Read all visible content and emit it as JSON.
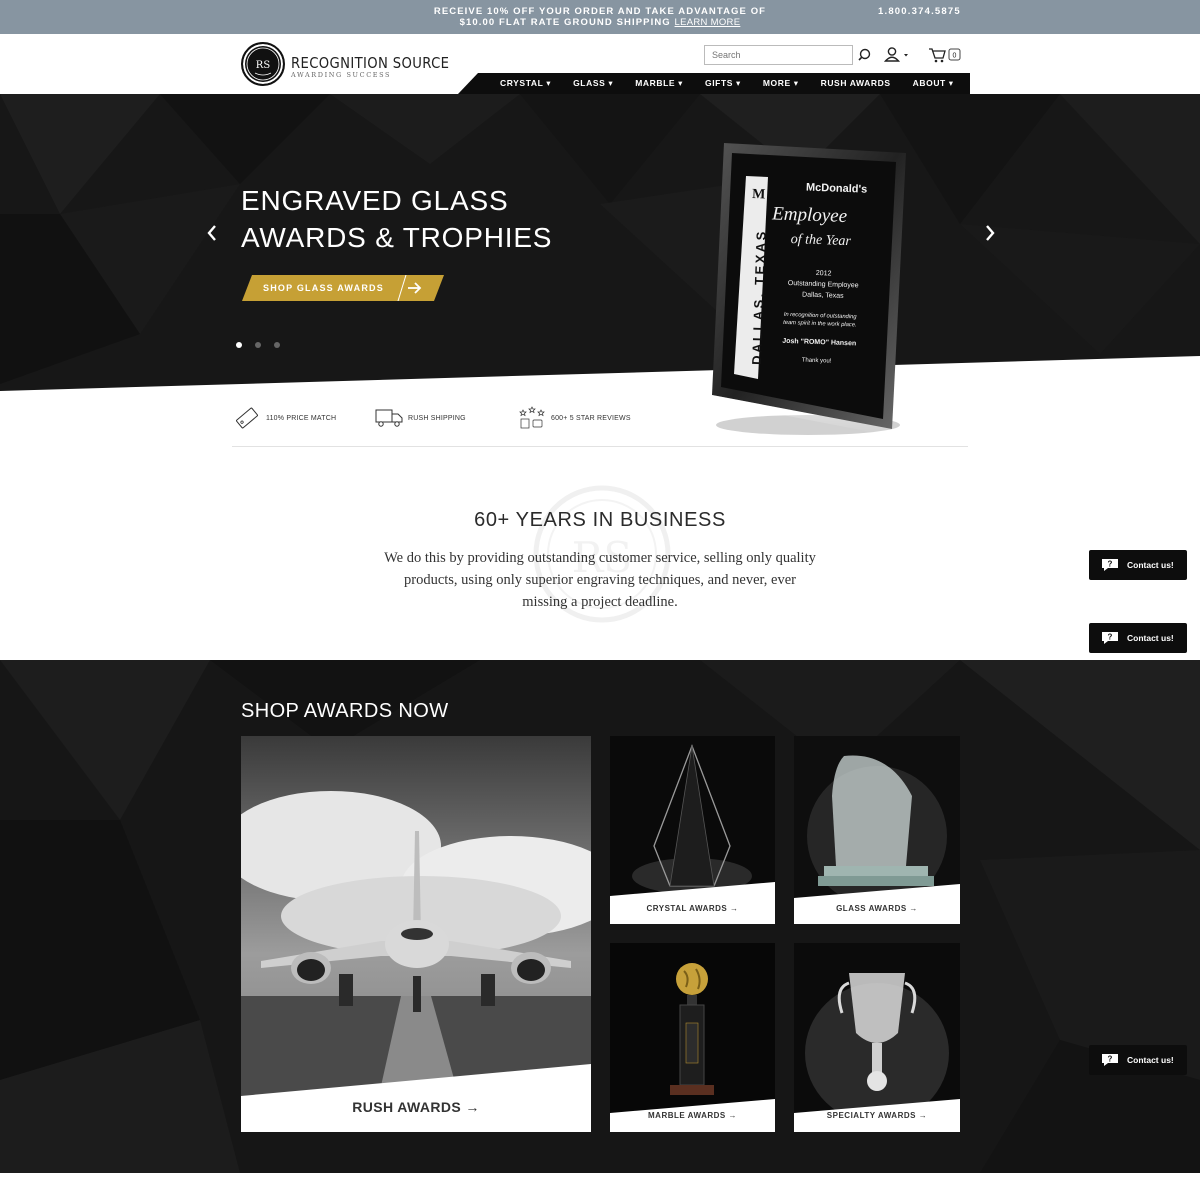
{
  "promo": {
    "line1": "RECEIVE 10% OFF YOUR ORDER AND TAKE ADVANTAGE OF",
    "line2": "$10.00 FLAT RATE GROUND SHIPPING",
    "learn_more": "LEARN MORE",
    "phone": "1.800.374.5875"
  },
  "header": {
    "logo_monogram": "RS",
    "logo_name": "RECOGNITION SOURCE",
    "logo_tagline": "AWARDING SUCCESS",
    "search_placeholder": "Search",
    "cart_count": "0"
  },
  "nav": {
    "items": [
      {
        "label": "CRYSTAL ▾"
      },
      {
        "label": "GLASS ▾"
      },
      {
        "label": "MARBLE ▾"
      },
      {
        "label": "GIFTS ▾"
      },
      {
        "label": "MORE ▾"
      },
      {
        "label": "RUSH AWARDS"
      },
      {
        "label": "ABOUT ▾"
      }
    ]
  },
  "hero": {
    "title_line1": "ENGRAVED GLASS",
    "title_line2": "AWARDS & TROPHIES",
    "cta_label": "SHOP GLASS AWARDS",
    "slide_count": 3,
    "active_slide": 1,
    "plaque": {
      "vertical_text": "DALLAS, TEXAS",
      "brand": "McDonald's",
      "line_employee": "Employee",
      "line_of_the_year": "of the Year",
      "year": "2012",
      "subtitle1": "Outstanding Employee",
      "subtitle2": "Dallas, Texas",
      "recog1": "In recognition of outstanding",
      "recog2": "team spirit in the work place.",
      "name": "Josh \"ROMO\" Hansen",
      "thanks": "Thank you!"
    }
  },
  "features": [
    {
      "label": "110% PRICE MATCH",
      "icon": "price-tag-icon"
    },
    {
      "label": "RUSH SHIPPING",
      "icon": "truck-icon"
    },
    {
      "label": "600+ 5 STAR REVIEWS",
      "icon": "stars-review-icon"
    }
  ],
  "about": {
    "title": "60+ YEARS IN BUSINESS",
    "line1": "We do this by providing outstanding customer service, selling only quality",
    "line2": "products, using only superior engraving techniques, and never, ever",
    "line3": "missing a project deadline."
  },
  "shop": {
    "title": "SHOP AWARDS NOW",
    "tiles": [
      {
        "label": "RUSH AWARDS"
      },
      {
        "label": "CRYSTAL AWARDS"
      },
      {
        "label": "GLASS AWARDS"
      },
      {
        "label": "MARBLE AWARDS"
      },
      {
        "label": "SPECIALTY AWARDS"
      }
    ]
  },
  "contact": {
    "label": "Contact us!"
  },
  "colors": {
    "promo_bar": "#8795a1",
    "nav_bg": "#0d0d0d",
    "gold_accent": "#c6a035",
    "dark_bg": "#161616"
  }
}
